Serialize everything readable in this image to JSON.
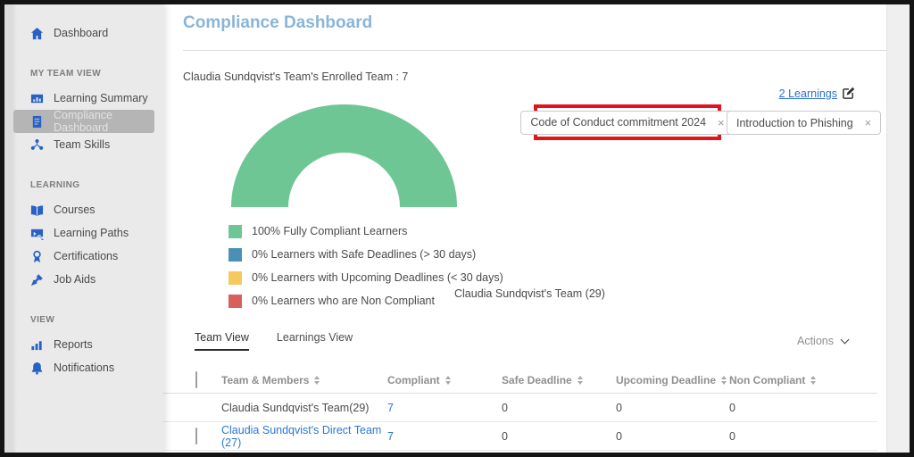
{
  "sidebar": {
    "dashboard": {
      "label": "Dashboard"
    },
    "sections": [
      {
        "title": "MY TEAM VIEW",
        "items": [
          {
            "label": "Learning Summary"
          },
          {
            "label": "Compliance Dashboard",
            "selected": true
          },
          {
            "label": "Team Skills"
          }
        ]
      },
      {
        "title": "LEARNING",
        "items": [
          {
            "label": "Courses"
          },
          {
            "label": "Learning Paths"
          },
          {
            "label": "Certifications"
          },
          {
            "label": "Job Aids"
          }
        ]
      },
      {
        "title": "VIEW",
        "items": [
          {
            "label": "Reports"
          },
          {
            "label": "Notifications"
          }
        ]
      }
    ]
  },
  "main": {
    "page_title": "Compliance Dashboard",
    "enrolled_summary": "Claudia Sundqvist's Team's Enrolled Team : 7",
    "learnings_link": "2 Learnings",
    "filters": [
      {
        "label": "Code of Conduct commitment 2024",
        "close": "×",
        "highlighted": true
      },
      {
        "label": "Introduction to Phishing",
        "close": "×",
        "highlighted": false
      }
    ],
    "tabs": [
      {
        "label": "Team View",
        "active": true
      },
      {
        "label": "Learnings View",
        "active": false
      }
    ],
    "actions_label": "Actions"
  },
  "chart_data": {
    "type": "pie",
    "variant": "semi-donut",
    "title": "Claudia Sundqvist's Team (29)",
    "legend_position": "bottom-left",
    "slices": [
      {
        "label": "100% Fully Compliant Learners",
        "value": 100,
        "color": "#6ec695"
      },
      {
        "label": "0% Learners with Safe Deadlines (> 30 days)",
        "value": 0,
        "color": "#4a90b5"
      },
      {
        "label": "0% Learners with Upcoming Deadlines (< 30 days)",
        "value": 0,
        "color": "#f6c95f"
      },
      {
        "label": "0% Learners who are Non Compliant",
        "value": 0,
        "color": "#d95f5c"
      }
    ]
  },
  "table": {
    "headers": [
      "Team & Members",
      "Compliant",
      "Safe Deadline",
      "Upcoming Deadline",
      "Non Compliant"
    ],
    "rows": [
      {
        "team": "Claudia Sundqvist's Team(29)",
        "compliant": "7",
        "safe_deadline": "0",
        "upcoming_deadline": "0",
        "non_compliant": "0"
      },
      {
        "team": "Claudia Sundqvist's Direct Team (27)",
        "compliant": "7",
        "safe_deadline": "0",
        "upcoming_deadline": "0",
        "non_compliant": "0"
      }
    ]
  },
  "colors": {
    "title": "#8ab5d8",
    "link": "#2c71d2",
    "annotation_red": "#e3131b",
    "sidebar_selected": "#b5b5b5",
    "icon_blue": "#2760c6"
  }
}
